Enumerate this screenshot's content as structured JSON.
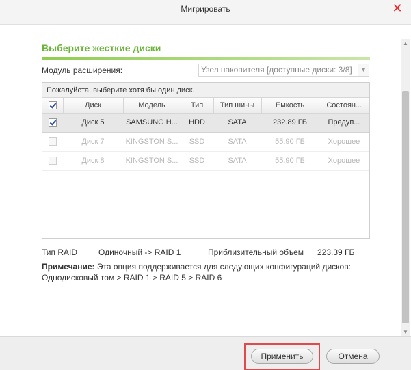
{
  "window": {
    "title": "Мигрировать",
    "close_icon": "close-icon"
  },
  "heading": "Выберите жесткие диски",
  "module": {
    "label": "Модуль расширения:",
    "selected": "Узел накопителя [доступные диски: 3/8]"
  },
  "panel": {
    "hint": "Пожалуйста, выберите хотя бы один диск.",
    "columns": [
      "Диск",
      "Модель",
      "Тип",
      "Тип шины",
      "Емкость",
      "Состоян..."
    ],
    "rows": [
      {
        "disk": "Диск 5",
        "model": "SAMSUNG H...",
        "type": "HDD",
        "bus": "SATA",
        "capacity": "232.89 ГБ",
        "status": "Предуп...",
        "checked": true,
        "enabled": true
      },
      {
        "disk": "Диск 7",
        "model": "KINGSTON S...",
        "type": "SSD",
        "bus": "SATA",
        "capacity": "55.90 ГБ",
        "status": "Хорошее",
        "checked": false,
        "enabled": false
      },
      {
        "disk": "Диск 8",
        "model": "KINGSTON S...",
        "type": "SSD",
        "bus": "SATA",
        "capacity": "55.90 ГБ",
        "status": "Хорошее",
        "checked": false,
        "enabled": false
      }
    ],
    "header_checkbox_checked": true
  },
  "raid": {
    "type_label": "Тип RAID",
    "type_value": "Одиночный -> RAID 1",
    "approx_label": "Приблизительный объем",
    "approx_value": "223.39 ГБ"
  },
  "note": {
    "label": "Примечание:",
    "text": " Эта опция поддерживается для следующих конфигураций дисков:",
    "line2": "Однодисковый том > RAID 1 > RAID 5 > RAID 6"
  },
  "footer": {
    "apply_label": "Применить",
    "cancel_label": "Отмена"
  },
  "colors": {
    "accent": "#6ab437",
    "highlight": "#e04a4a"
  }
}
